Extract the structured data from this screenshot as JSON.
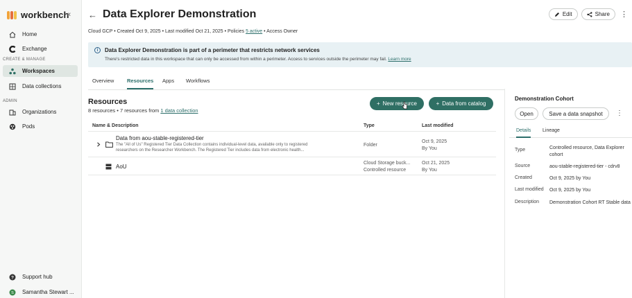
{
  "sidebar": {
    "brand": "workbench",
    "collapse": "«",
    "items": [
      {
        "label": "Home"
      },
      {
        "label": "Exchange"
      },
      {
        "label": "Workspaces"
      },
      {
        "label": "Data collections"
      },
      {
        "label": "Organizations"
      },
      {
        "label": "Pods"
      }
    ],
    "section_create": "CREATE & MANAGE",
    "section_admin": "ADMIN",
    "footer": [
      {
        "label": "Support hub"
      },
      {
        "label": "Samantha Stewart ..."
      }
    ],
    "avatar_initial": "S"
  },
  "header": {
    "back": "←",
    "title": "Data Explorer Demonstration",
    "edit": "Edit",
    "share": "Share",
    "meta_prefix": "Cloud GCP  •  Created Oct 9, 2025  •  Last modified Oct 21, 2025  •  Policies ",
    "policies_link": "5 active",
    "meta_suffix": "  •  Access Owner"
  },
  "banner": {
    "title": "Data Explorer Demonstration is part of a perimeter that restricts network services",
    "body": "There's restricted data in this workspace that can only be accessed from within a perimeter. Access to services outside the perimeter may fail. ",
    "link": "Learn more"
  },
  "tabs": [
    "Overview",
    "Resources",
    "Apps",
    "Workflows"
  ],
  "resources": {
    "title": "Resources",
    "subtitle_prefix": "8 resources • 7 resources from ",
    "subtitle_link": "1 data collection",
    "new_resource": "New resource",
    "data_catalog": "Data from catalog",
    "columns": [
      "Name & Description",
      "Type",
      "Last modified"
    ],
    "rows": [
      {
        "name": "Data from aou-stable-registered-tier",
        "desc1": "The \"All of Us\" Registered Tier Data Collection contains individual-level data, available only to registered",
        "desc2": "researchers on the Researcher Workbench. The Registered Tier includes data from electronic health...",
        "type1": "Folder",
        "type2": "",
        "mod1": "Oct 9, 2025",
        "mod2": "By You"
      },
      {
        "name": "AoU",
        "type1": "Cloud Storage buck...",
        "type2": "Controlled resource",
        "mod1": "Oct 21, 2025",
        "mod2": "By You"
      }
    ]
  },
  "panel": {
    "title": "Demonstration Cohort",
    "open": "Open",
    "snapshot": "Save a data snapshot",
    "tabs": [
      "Details",
      "Lineage"
    ],
    "details": [
      {
        "k": "Type",
        "v1": "Controlled resource, Data Explorer",
        "v2": "cohort"
      },
      {
        "k": "Source",
        "v1": "aou-stable-registered-tier - cdrv8",
        "v2": ""
      },
      {
        "k": "Created",
        "v1": "Oct 9, 2025 by You",
        "v2": ""
      },
      {
        "k": "Last modified",
        "v1": "Oct 9, 2025 by You",
        "v2": ""
      },
      {
        "k": "Description",
        "v1": "Demonstration Cohort RT Stable data",
        "v2": ""
      }
    ]
  },
  "colors": {
    "accent": "#2c6e6a",
    "button": "#2f6f64",
    "banner": "#e8f1f4"
  }
}
